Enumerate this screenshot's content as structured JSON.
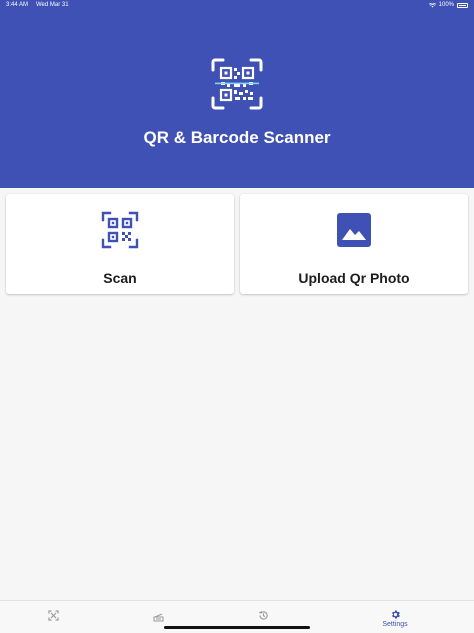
{
  "status_bar": {
    "time": "3:44 AM",
    "date": "Wed Mar 31",
    "battery": "100%"
  },
  "header": {
    "title": "QR & Barcode Scanner",
    "logo_icon": "qr-scan-icon"
  },
  "cards": [
    {
      "label": "Scan",
      "icon": "qr-code-icon"
    },
    {
      "label": "Upload Qr Photo",
      "icon": "image-icon"
    }
  ],
  "tab_bar": {
    "tabs": [
      {
        "label": "",
        "icon": "scan-frame-icon"
      },
      {
        "label": "",
        "icon": "scanner-icon"
      },
      {
        "label": "",
        "icon": "history-icon"
      },
      {
        "label": "Settings",
        "icon": "gear-icon"
      }
    ]
  },
  "colors": {
    "brand": "#3f51b5",
    "background": "#f6f6f7",
    "card": "#ffffff",
    "tab_inactive": "#9a9a9e"
  }
}
